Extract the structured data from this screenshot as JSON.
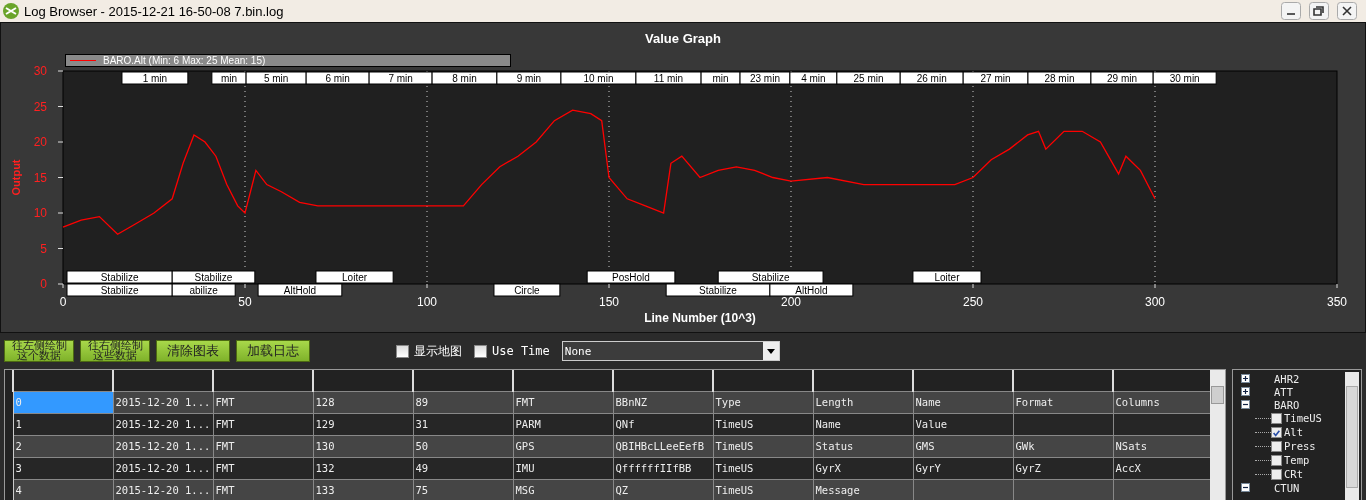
{
  "window": {
    "title": "Log Browser - 2015-12-21 16-50-08 7.bin.log"
  },
  "graph": {
    "legend_stats": "(Min: 6 Max: 25 Mean: 15)",
    "chart_data": {
      "type": "line",
      "grid": true,
      "xlabel": "Line Number (10^3)",
      "ylabel": "Output",
      "xlim": [
        0,
        350
      ],
      "ylim": [
        0,
        30
      ],
      "xticks": [
        0,
        50,
        100,
        150,
        200,
        250,
        300,
        350
      ],
      "yticks": [
        0,
        5,
        10,
        15,
        20,
        25,
        30
      ],
      "x": [
        0,
        5,
        10,
        15,
        20,
        25,
        30,
        33,
        36,
        39,
        42,
        45,
        48,
        50,
        53,
        56,
        60,
        65,
        70,
        80,
        90,
        100,
        110,
        115,
        120,
        125,
        130,
        135,
        140,
        145,
        148,
        150,
        155,
        160,
        165,
        167,
        170,
        175,
        180,
        185,
        190,
        195,
        200,
        210,
        220,
        230,
        240,
        245,
        250,
        255,
        260,
        265,
        268,
        270,
        275,
        280,
        285,
        290,
        292,
        296,
        300
      ],
      "series": [
        {
          "name": "BARO.Alt",
          "color": "#ff0000",
          "values": [
            8,
            9,
            9.5,
            7,
            8.5,
            10,
            12,
            17,
            21,
            20,
            18,
            14,
            11,
            10,
            16,
            14,
            13,
            11.5,
            11,
            11,
            11,
            11,
            11,
            14,
            16.5,
            18,
            20,
            23,
            24.5,
            24,
            23,
            15,
            12,
            11,
            10,
            17,
            18,
            15,
            16,
            16.5,
            16,
            15,
            14.5,
            15,
            14,
            14,
            14,
            14,
            15,
            17.5,
            19,
            21,
            21.5,
            19,
            21.5,
            21.5,
            20,
            15.5,
            18,
            16,
            12
          ]
        }
      ],
      "title": "Value Graph"
    },
    "marker_rows": [
      {
        "kind": "time",
        "markers": [
          "1 min",
          "min",
          "5 min",
          "6 min",
          "7 min",
          "8 min",
          "9 min",
          "10 min",
          "11 min",
          "min",
          "23 min",
          "4 min",
          "25 min",
          "26 min",
          "27 min",
          "28 min",
          "29 min",
          "30 min"
        ]
      },
      {
        "kind": "mode",
        "markers": [
          "Stabilize",
          "Stabilize",
          "Loiter",
          "PosHold",
          "Stabilize",
          "Loiter"
        ]
      },
      {
        "kind": "mode",
        "markers": [
          "Stabilize",
          "abilize",
          "AltHold",
          "Circle",
          "Stabilize",
          "AltHold"
        ]
      }
    ]
  },
  "controls": {
    "buttons": [
      {
        "lines": [
          "往左侧绘制",
          "这个数据"
        ]
      },
      {
        "lines": [
          "往右侧绘制",
          "这些数据"
        ]
      },
      {
        "lines": [
          "清除图表"
        ]
      },
      {
        "lines": [
          "加载日志"
        ]
      }
    ],
    "checkboxes": [
      {
        "label": "显示地图",
        "checked": false
      },
      {
        "label": "Use Time",
        "checked": false
      }
    ],
    "dropdown": {
      "value": "None"
    }
  },
  "table": {
    "rows": [
      {
        "selected": true,
        "cells": [
          "0",
          "2015-12-20 1...",
          "FMT",
          "128",
          "89",
          "FMT",
          "BBnNZ",
          "Type",
          "Length",
          "Name",
          "Format",
          "Columns"
        ]
      },
      {
        "selected": false,
        "cells": [
          "1",
          "2015-12-20 1...",
          "FMT",
          "129",
          "31",
          "PARM",
          "QNf",
          "TimeUS",
          "Name",
          "Value",
          null,
          null
        ]
      },
      {
        "selected": false,
        "cells": [
          "2",
          "2015-12-20 1...",
          "FMT",
          "130",
          "50",
          "GPS",
          "QBIHBcLLeeEefB",
          "TimeUS",
          "Status",
          "GMS",
          "GWk",
          "NSats"
        ]
      },
      {
        "selected": false,
        "cells": [
          "3",
          "2015-12-20 1...",
          "FMT",
          "132",
          "49",
          "IMU",
          "QffffffIIfBB",
          "TimeUS",
          "GyrX",
          "GyrY",
          "GyrZ",
          "AccX"
        ]
      },
      {
        "selected": false,
        "cells": [
          "4",
          "2015-12-20 1...",
          "FMT",
          "133",
          "75",
          "MSG",
          "QZ",
          "TimeUS",
          "Message",
          null,
          null,
          null
        ]
      }
    ]
  },
  "tree": [
    {
      "label": "AHR2",
      "expanded": false
    },
    {
      "label": "ATT",
      "expanded": false
    },
    {
      "label": "BARO",
      "expanded": true,
      "children": [
        {
          "label": "TimeUS",
          "checked": false
        },
        {
          "label": "Alt",
          "checked": true
        },
        {
          "label": "Press",
          "checked": false
        },
        {
          "label": "Temp",
          "checked": false
        },
        {
          "label": "CRt",
          "checked": false
        }
      ]
    },
    {
      "label": "CTUN",
      "expanded": true
    }
  ]
}
